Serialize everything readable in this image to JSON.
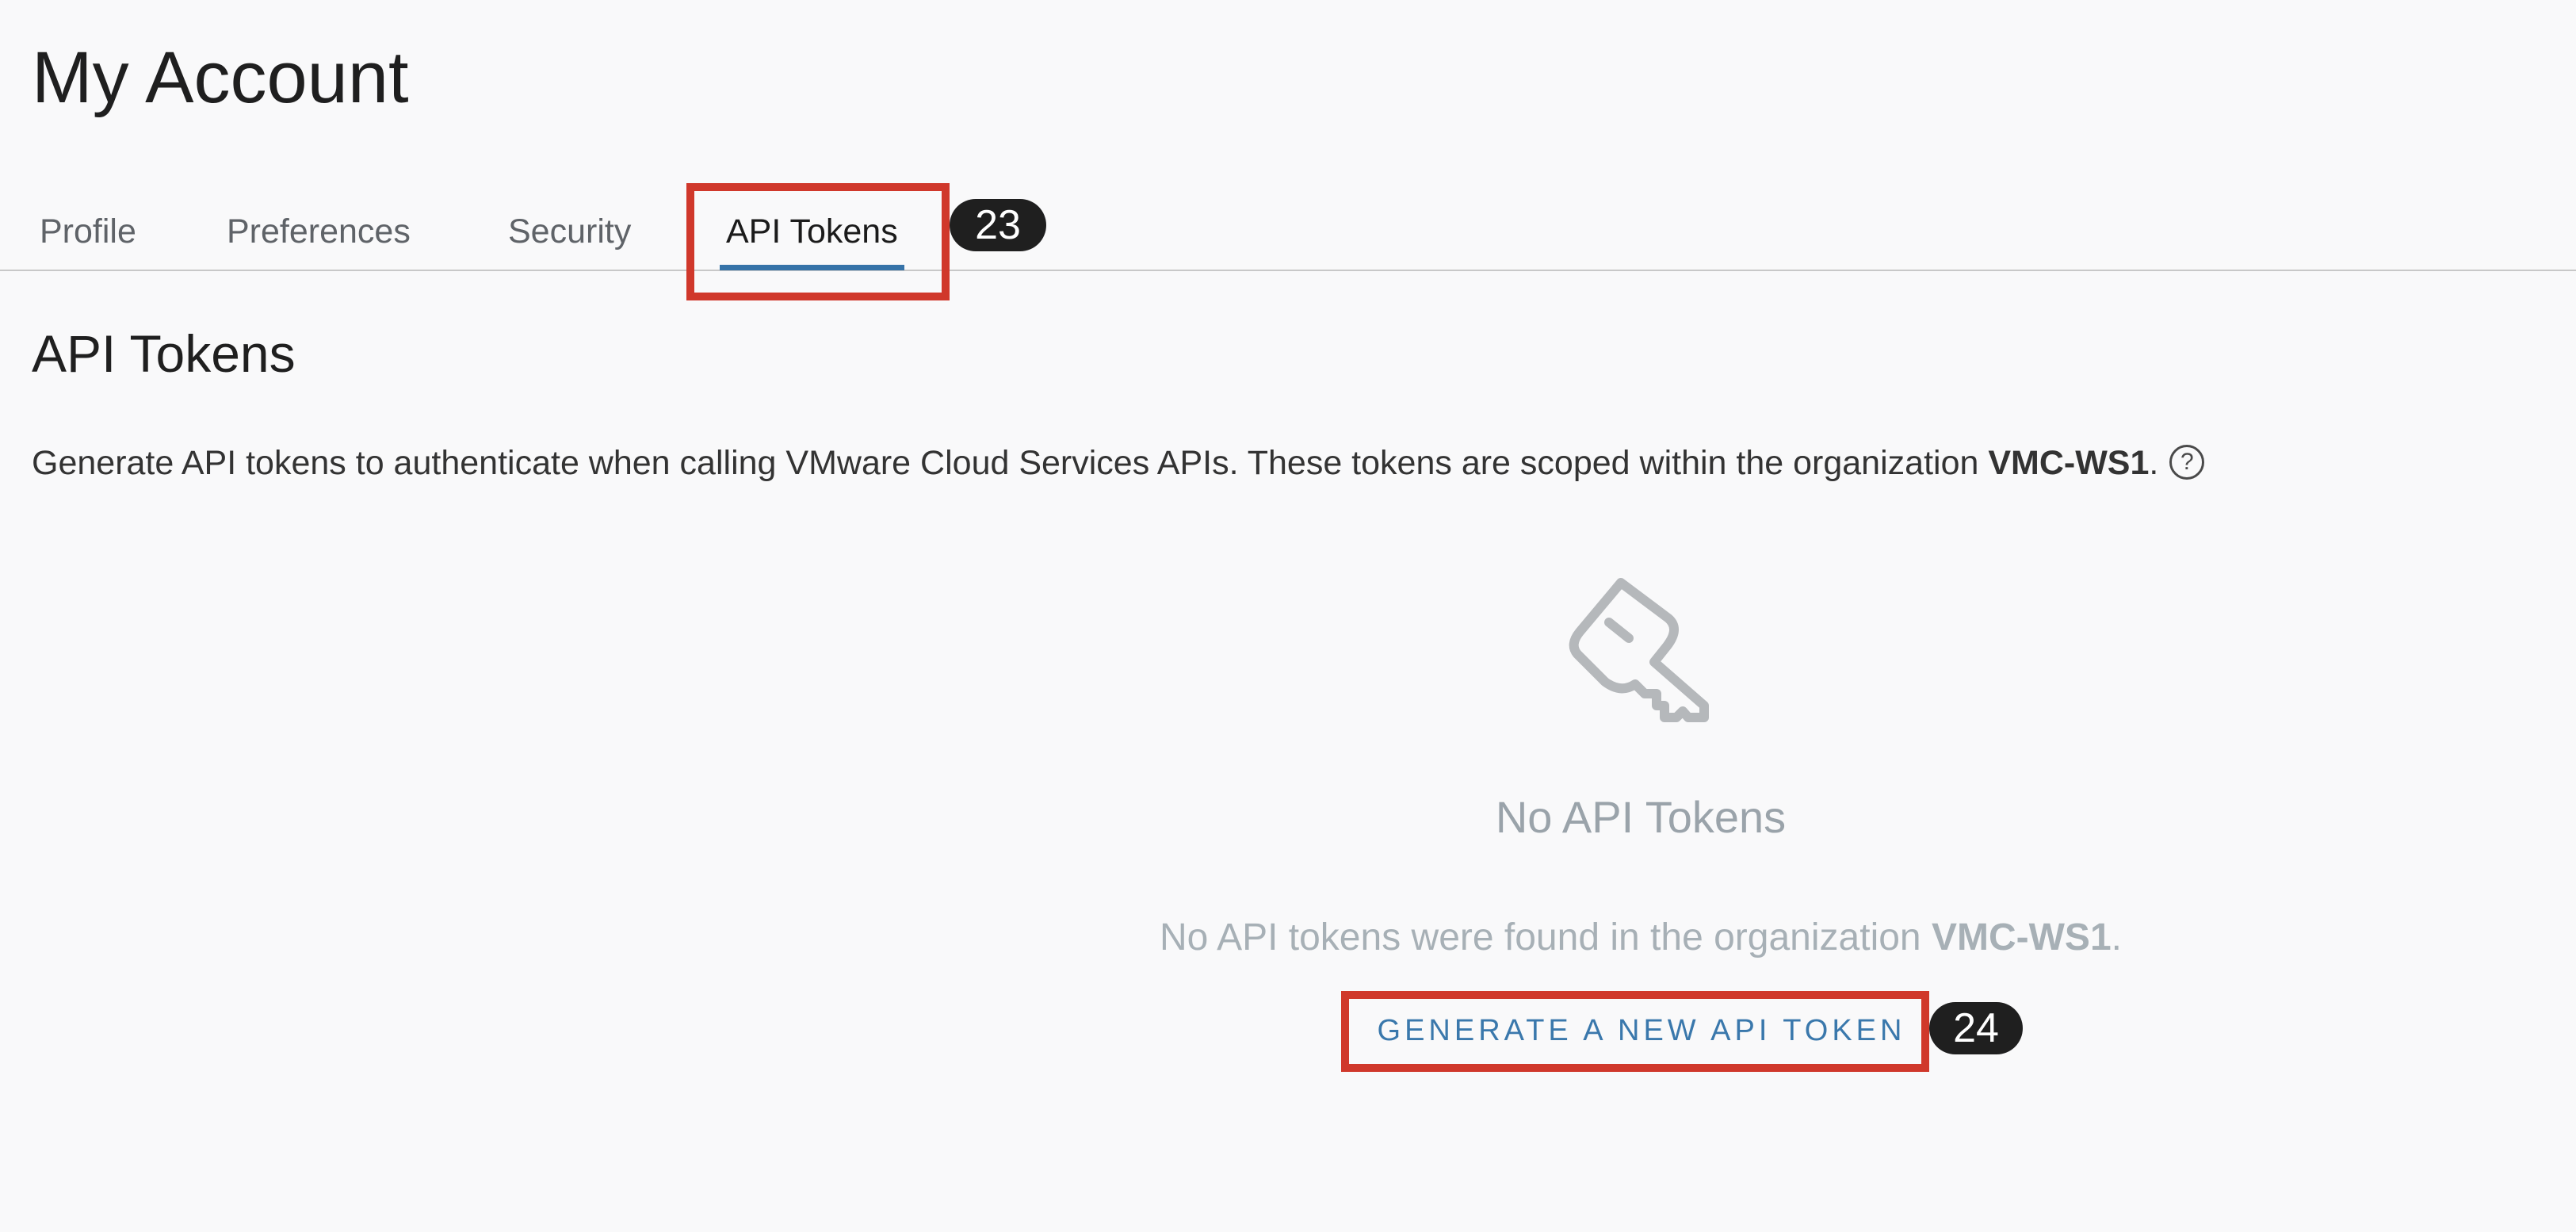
{
  "page": {
    "title": "My Account"
  },
  "tabs": [
    {
      "label": "Profile",
      "active": false
    },
    {
      "label": "Preferences",
      "active": false
    },
    {
      "label": "Security",
      "active": false
    },
    {
      "label": "API Tokens",
      "active": true
    }
  ],
  "section": {
    "title": "API Tokens",
    "description_prefix": "Generate API tokens to authenticate when calling VMware Cloud Services APIs. These tokens are scoped within the organization ",
    "org_name": "VMC-WS1",
    "description_suffix": ".",
    "help_icon": "question-circle-icon",
    "help_glyph": "?"
  },
  "empty_state": {
    "icon": "key-icon",
    "title": "No API Tokens",
    "message_prefix": "No API tokens were found in the organization ",
    "org_name": "VMC-WS1",
    "message_suffix": ".",
    "action_label": "GENERATE A NEW API TOKEN"
  },
  "annotations": [
    {
      "label": "23"
    },
    {
      "label": "24"
    }
  ],
  "colors": {
    "accent": "#3673a8",
    "annotation": "#d0382b",
    "background": "#f9f9fa"
  }
}
